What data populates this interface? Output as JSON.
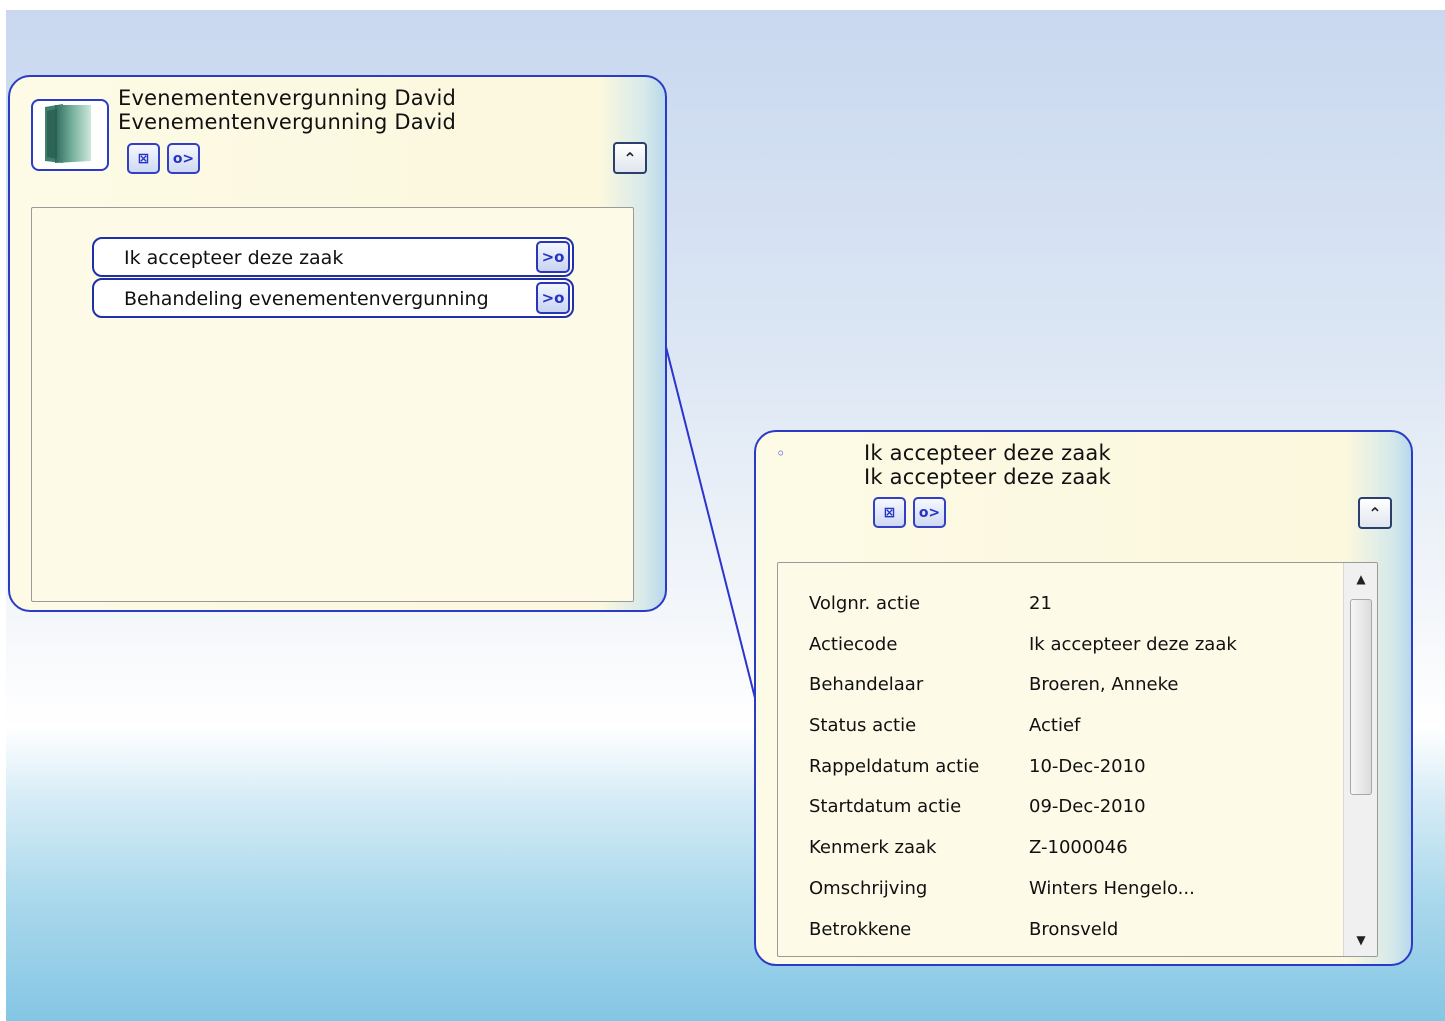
{
  "case_node": {
    "title_line1": "Evenementenvergunning David",
    "title_line2": "Evenementenvergunning David",
    "icon": "document-folder-icon",
    "tool_buttons": [
      {
        "name": "focus-button",
        "glyph": "⊠",
        "icon": "focus-icon"
      },
      {
        "name": "open-button",
        "glyph": "o>",
        "icon": "open-link-icon"
      }
    ],
    "collapse_glyph": "⌃",
    "actions": [
      {
        "label": "Ik accepteer deze zaak",
        "go_glyph": ">o"
      },
      {
        "label": "Behandeling evenementenvergunning",
        "go_glyph": ">o"
      }
    ]
  },
  "action_node": {
    "title_line1": "Ik accepteer deze zaak",
    "title_line2": "Ik accepteer deze zaak",
    "bullet": "◦",
    "tool_buttons": [
      {
        "name": "focus-button",
        "glyph": "⊠",
        "icon": "focus-icon"
      },
      {
        "name": "open-button",
        "glyph": "o>",
        "icon": "open-link-icon"
      }
    ],
    "collapse_glyph": "⌃",
    "properties": [
      {
        "key": "Volgnr. actie",
        "value": "21"
      },
      {
        "key": "Actiecode",
        "value": "Ik accepteer deze zaak"
      },
      {
        "key": "Behandelaar",
        "value": "Broeren, Anneke"
      },
      {
        "key": "Status actie",
        "value": "Actief"
      },
      {
        "key": "Rappeldatum actie",
        "value": "10-Dec-2010"
      },
      {
        "key": "Startdatum actie",
        "value": "09-Dec-2010"
      },
      {
        "key": "Kenmerk zaak",
        "value": "Z-1000046"
      },
      {
        "key": "Omschrijving",
        "value": "Winters Hengelo..."
      },
      {
        "key": "Betrokkene",
        "value": "Bronsveld"
      }
    ],
    "scroll_up_glyph": "▲",
    "scroll_down_glyph": "▼"
  },
  "colors": {
    "node_border": "#2b3bc7",
    "node_fill": "#fcf8de",
    "connector": "#2b34d0"
  }
}
